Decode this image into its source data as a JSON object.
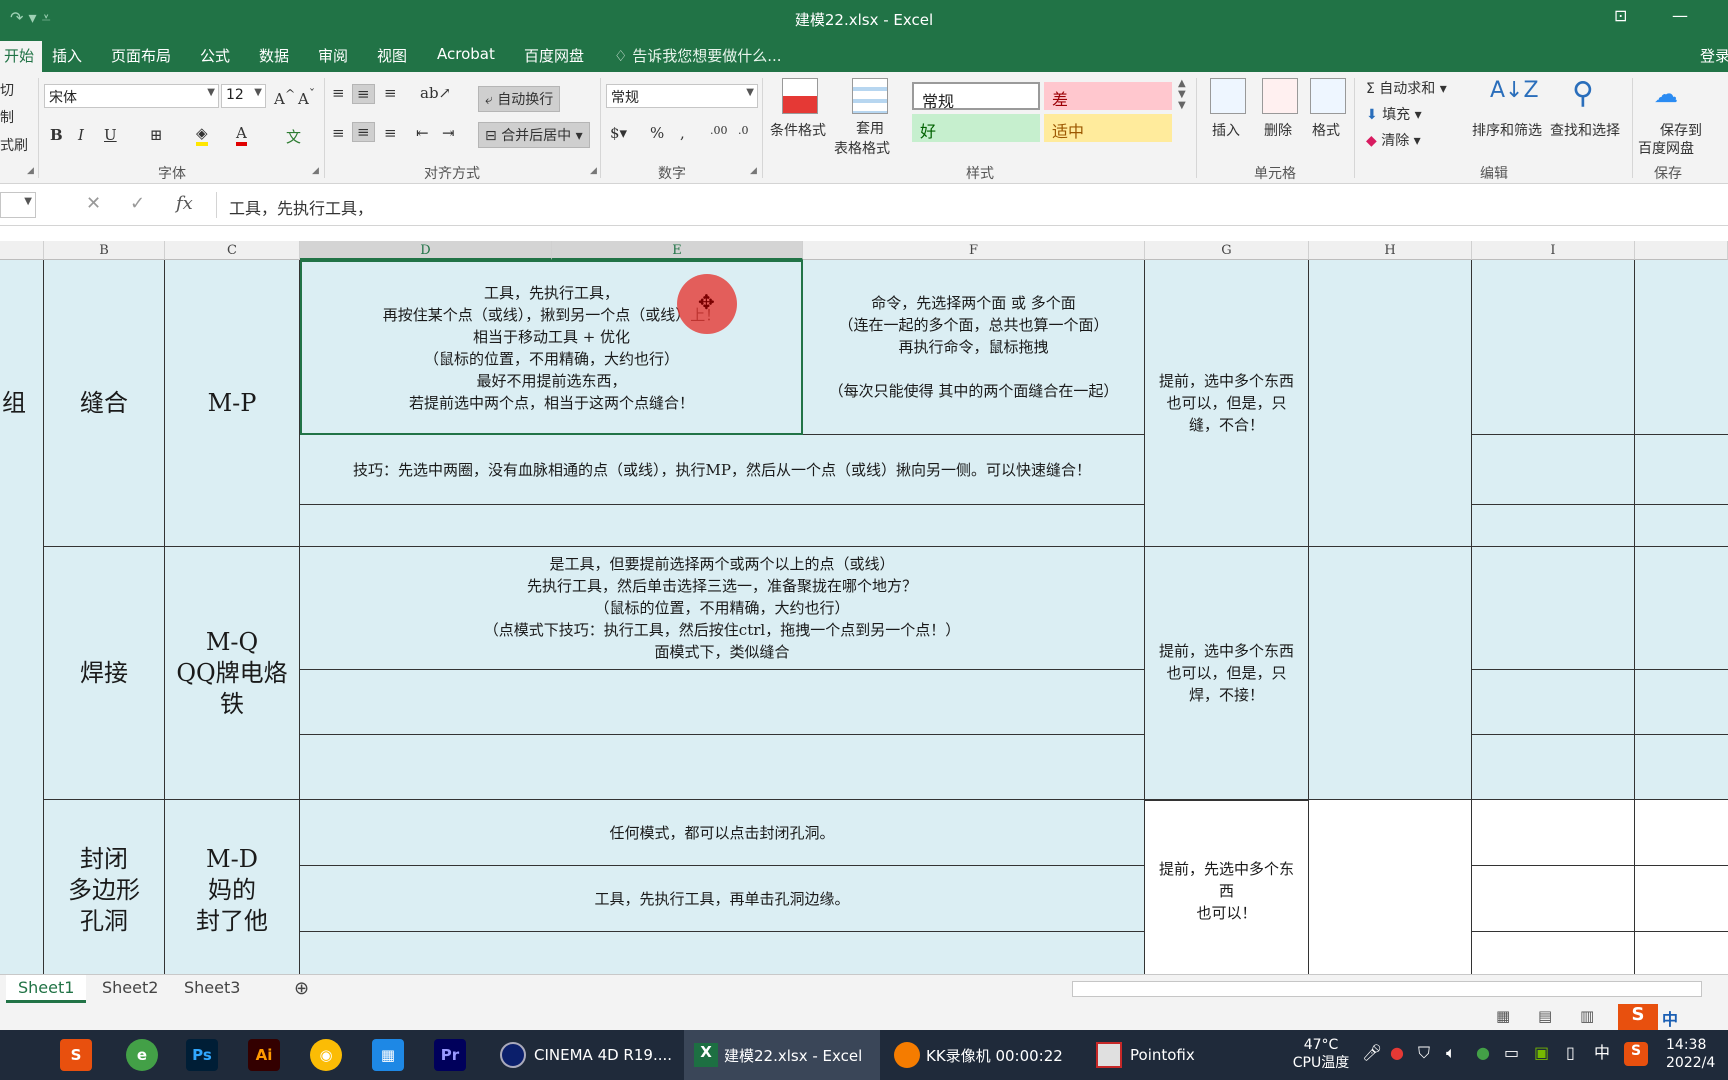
{
  "window": {
    "title": "建模22.xlsx - Excel",
    "login": "登录"
  },
  "tabs": [
    "开始",
    "插入",
    "页面布局",
    "公式",
    "数据",
    "审阅",
    "视图",
    "Acrobat",
    "百度网盘"
  ],
  "tell_me": "告诉我您想要做什么...",
  "ribbon": {
    "clipboard": {
      "cut": "切",
      "copy": "制",
      "format_painter": "式刷"
    },
    "font": {
      "name": "宋体",
      "size": "12",
      "bold": "B",
      "italic": "I",
      "underline": "U",
      "label": "字体"
    },
    "alignment": {
      "wrap": "自动换行",
      "merge": "合并后居中",
      "label": "对齐方式"
    },
    "number": {
      "format": "常规",
      "label": "数字"
    },
    "styles": {
      "conditional": "条件格式",
      "table_fmt_1": "套用",
      "table_fmt_2": "表格格式",
      "normal": "常规",
      "bad": "差",
      "good": "好",
      "neutral": "适中",
      "label": "样式"
    },
    "cells": {
      "insert": "插入",
      "delete": "删除",
      "format": "格式",
      "label": "单元格"
    },
    "editing": {
      "autosum": "自动求和",
      "fill": "填充",
      "clear": "清除",
      "sort": "排序和筛选",
      "find": "查找和选择",
      "label": "编辑"
    },
    "save": {
      "line1": "保存到",
      "line2": "百度网盘",
      "label": "保存"
    }
  },
  "formula": {
    "value": "工具，先执行工具，"
  },
  "columns": [
    "B",
    "C",
    "D",
    "E",
    "F",
    "G",
    "H",
    "I"
  ],
  "rows": {
    "a_label": "组",
    "r1_name": "缝合",
    "r1_key": "M-P",
    "r1_de_text": "工具，先执行工具，\n再按住某个点（或线），揪到另一个点（或线）上！\n相当于移动工具 + 优化\n（鼠标的位置，不用精确，大约也行）\n最好不用提前选东西，\n若提前选中两个点，相当于这两个点缝合！",
    "r1_f_text": "命令，先选择两个面 或 多个面\n（连在一起的多个面，总共也算一个面）\n再执行命令，鼠标拖拽\n\n（每次只能使得 其中的两个面缝合在一起）",
    "r1_g_text": "提前，选中多个东西\n也可以，但是，只\n缝，不合！",
    "r1_tip": "技巧：先选中两圈，没有血脉相通的点（或线），执行MP，然后从一个点（或线）揪向另一侧。可以快速缝合！",
    "r2_name": "焊接",
    "r2_key": "M-Q\nQQ牌电烙\n铁",
    "r2_text": "是工具，但要提前选择两个或两个以上的点（或线）\n先执行工具，然后单击选择三选一，准备聚拢在哪个地方？\n（鼠标的位置，不用精确，大约也行）\n（点模式下技巧：执行工具，然后按住ctrl，拖拽一个点到另一个点！）\n面模式下，类似缝合",
    "r2_g_text": "提前，选中多个东西\n也可以，但是，只\n焊，不接！",
    "r3_name": "封闭\n多边形\n孔洞",
    "r3_key": "M-D\n妈的\n封了他",
    "r3_text1": "任何模式，都可以点击封闭孔洞。",
    "r3_text2": "工具，先执行工具，再单击孔洞边缘。",
    "r3_g_text": "提前，先选中多个东\n西\n也可以！"
  },
  "sheets": [
    "Sheet1",
    "Sheet2",
    "Sheet3"
  ],
  "taskbar": {
    "apps": [
      {
        "label": "CINEMA 4D R19...."
      },
      {
        "label": "建模22.xlsx - Excel"
      },
      {
        "label": "KK录像机 00:00:22"
      },
      {
        "label": "Pointofix"
      }
    ],
    "temp": "47°C",
    "temp_label": "CPU温度",
    "ime": "中",
    "time": "14:38",
    "date": "2022/4"
  },
  "colors": {
    "excel_green": "#217346",
    "cell_fill": "#dbeef3",
    "cursor_red": "#e53935"
  }
}
